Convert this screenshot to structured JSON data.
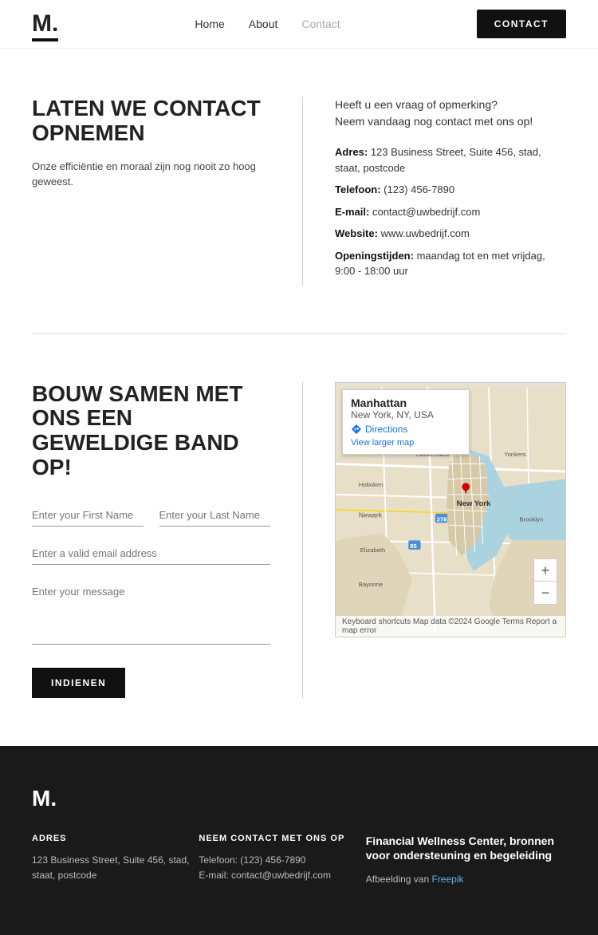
{
  "nav": {
    "logo": "M.",
    "links": [
      {
        "label": "Home",
        "active": false
      },
      {
        "label": "About",
        "active": false
      },
      {
        "label": "Contact",
        "active": true
      }
    ],
    "contact_button": "CONTACT"
  },
  "section1": {
    "heading": "LATEN WE CONTACT OPNEMEN",
    "subtext": "Onze efficiëntie en moraal zijn nog nooit zo hoog geweest.",
    "intro_line1": "Heeft u een vraag of opmerking?",
    "intro_line2": "Neem vandaag nog contact met ons op!",
    "address_label": "Adres:",
    "address_value": "123 Business Street, Suite 456, stad, staat, postcode",
    "phone_label": "Telefoon:",
    "phone_value": "(123) 456-7890",
    "email_label": "E-mail:",
    "email_value": "contact@uwbedrijf.com",
    "website_label": "Website:",
    "website_value": "www.uwbedrijf.com",
    "hours_label": "Openingstijden:",
    "hours_value": "maandag tot en met vrijdag, 9:00 - 18:00 uur"
  },
  "section2": {
    "heading": "BOUW SAMEN MET ONS EEN GEWELDIGE BAND OP!",
    "first_name_placeholder": "Enter your First Name",
    "last_name_placeholder": "Enter your Last Name",
    "email_placeholder": "Enter a valid email address",
    "message_placeholder": "Enter your message",
    "submit_label": "INDIENEN"
  },
  "map": {
    "place": "Manhattan",
    "state": "New York, NY, USA",
    "directions_label": "Directions",
    "view_larger": "View larger map",
    "zoom_in": "+",
    "zoom_out": "−",
    "bottom_bar": "Keyboard shortcuts  Map data ©2024 Google  Terms  Report a map error"
  },
  "footer": {
    "logo": "M.",
    "address_heading": "ADRES",
    "address_value": "123 Business Street, Suite 456, stad, staat, postcode",
    "contact_heading": "NEEM CONTACT MET ONS OP",
    "phone": "Telefoon: (123) 456-7890",
    "email": "E-mail: contact@uwbedrijf.com",
    "right_heading": "Financial Wellness Center, bronnen voor ondersteuning en begeleiding",
    "right_text": "Afbeelding van ",
    "right_link": "Freepik"
  }
}
